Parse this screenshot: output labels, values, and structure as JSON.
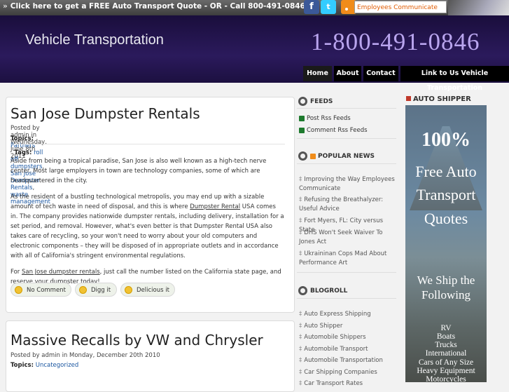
{
  "topbar": {
    "promo_arrow": "»",
    "promo_text": "Click here to get a FREE Auto Transport Quote  - OR -  Call 800-491-0846",
    "facebook": "f",
    "twitter": "t",
    "search_value": "Employees Communicate"
  },
  "header": {
    "site_title": "Vehicle Transportation",
    "phone": "1-800-491-0846"
  },
  "nav": [
    "Home",
    "About",
    "Contact",
    "Link to Us Vehicle Transportation"
  ],
  "posts": [
    {
      "title": "San Jose Dumpster Rentals",
      "posted": "Posted by admin in Wednesday, June 8th 2011",
      "topics_label": "Topics:",
      "topics": "Partners",
      "tags_label": "Tags:",
      "tags": [
        "roll off dumpsters",
        "San Jose Dumpster Rentals",
        "waste management"
      ],
      "p1": "Aside from being a tropical paradise, San Jose is also well known as a high-tech nerve center. Most large employers in town are technology companies, some of which are headquartered in the city.",
      "p2_a": "As the resident of a bustling technological metropolis, you may end up with a sizable amount of tech waste in need of disposal, and this is where ",
      "p2_link": "Dumpster Rental",
      "p2_b": " USA comes in. The company provides nationwide dumpster rentals, including delivery, installation for a set period, and removal. However, what's even better is that Dumpster Rental USA also takes care of recycling, so your won't need to worry about your old computers and electronic components – they will be disposed of in appropriate outlets and in accordance with all of California's stringent environmental regulations.",
      "p3_a": "For ",
      "p3_link": "San Jose dumpster rentals",
      "p3_b": ", just call the number listed on the California state page, and reserve your dumpster today!",
      "actions": [
        "No Comment",
        "Digg it",
        "Delicious it"
      ]
    },
    {
      "title": "Massive Recalls by VW and Chrysler",
      "posted": "Posted by admin in Monday, December 20th 2010",
      "topics_label": "Topics:",
      "topics": "Uncategorized"
    }
  ],
  "sidebar": {
    "feeds_title": "FEEDS",
    "feeds": [
      "Post Rss Feeds",
      "Comment Rss Feeds"
    ],
    "popular_title": "POPULAR NEWS",
    "popular": [
      "Improving the Way Employees Communicate",
      "Refusing the Breathalyzer: Useful Advice",
      "Fort Myers, FL: City versus State",
      "DHS Won't Seek Waiver To Jones Act",
      "Ukraininan Cops Mad About Performance Art"
    ],
    "blogroll_title": "BLOGROLL",
    "blogroll": [
      "Auto Express Shipping",
      "Auto Shipper",
      "Automobile Shippers",
      "Automobile Transport",
      "Automobile Transportation",
      "Car Shipping Companies",
      "Car Transport Rates"
    ]
  },
  "ad": {
    "heading": "AUTO SHIPPER",
    "pct": "100%",
    "line1": "Free Auto",
    "line2": "Transport",
    "line3": "Quotes",
    "ship1": "We Ship the",
    "ship2": "Following",
    "items": [
      "RV",
      "Boats",
      "Trucks",
      "International",
      "Cars of Any Size",
      "Heavy Equipment",
      "Motorcycles"
    ]
  }
}
